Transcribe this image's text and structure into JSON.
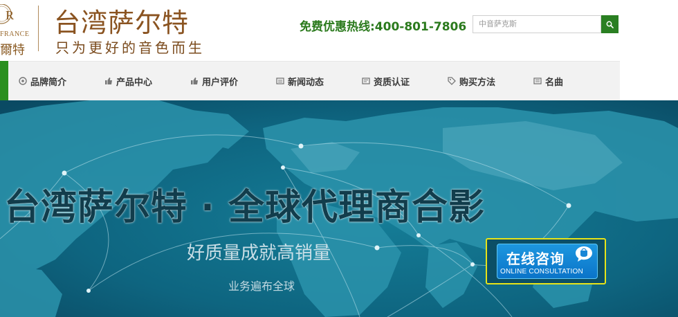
{
  "header": {
    "logo_text": "FRANCE",
    "logo_small_cn": "爾特",
    "brand_name": "台湾萨尔特",
    "brand_slogan": "只为更好的音色而生",
    "hotline": "免费优惠热线:400-801-7806"
  },
  "search": {
    "placeholder": "中音萨克斯",
    "button_icon": "search-icon"
  },
  "nav": {
    "items": [
      {
        "label": "品牌简介",
        "icon": "brand-icon"
      },
      {
        "label": "产品中心",
        "icon": "thumb-icon"
      },
      {
        "label": "用户评价",
        "icon": "thumb-icon"
      },
      {
        "label": "新闻动态",
        "icon": "news-icon"
      },
      {
        "label": "资质认证",
        "icon": "certificate-icon"
      },
      {
        "label": "购买方法",
        "icon": "tag-icon"
      },
      {
        "label": "名曲",
        "icon": "list-icon"
      }
    ]
  },
  "banner": {
    "title": "台湾萨尔特 · 全球代理商合影",
    "subtitle1": "好质量成就高销量",
    "subtitle2": "业务遍布全球"
  },
  "consult": {
    "label_cn": "在线咨询",
    "label_en": "ONLINE CONSULTATION",
    "icon": "chat-bubble-icon"
  },
  "colors": {
    "brand_brown": "#8a5320",
    "hotline_green": "#2b7a1d",
    "nav_accent": "#2a8f1f",
    "banner_blue": "#0e5b75",
    "consult_border": "#e8e418",
    "consult_blue": "#0a73c8"
  }
}
